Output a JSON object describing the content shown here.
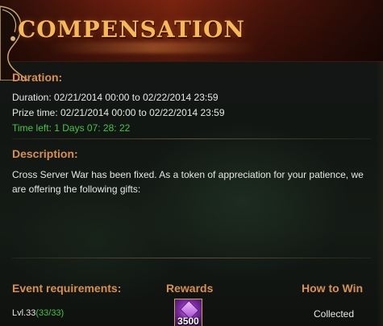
{
  "header": {
    "title": "Compensation"
  },
  "duration_section": {
    "heading": "Duration:",
    "duration_line": "Duration: 02/21/2014 00:00 to 02/22/2014 23:59",
    "prize_time_line": "Prize time: 02/21/2014 00:00 to 02/22/2014 23:59",
    "time_left_line": "Time left: 1  Days  07: 28: 22"
  },
  "description_section": {
    "heading": "Description:",
    "text": "Cross Server War has been fixed. As a token of appreciation for your patience, we are offering the following gifts:"
  },
  "table": {
    "headers": {
      "requirements": "Event requirements:",
      "rewards": "Rewards",
      "how_to_win": "How to Win"
    },
    "row": {
      "requirement_level": "Lvl.33",
      "requirement_progress": "(33/33)",
      "reward_item_icon": "purple-gem-icon",
      "reward_quantity": "3500",
      "status": "Collected"
    }
  },
  "colors": {
    "heading": "#d8904e",
    "title": "#f6b95a",
    "green_text": "#43c543",
    "body_text": "#e6e6e6"
  }
}
